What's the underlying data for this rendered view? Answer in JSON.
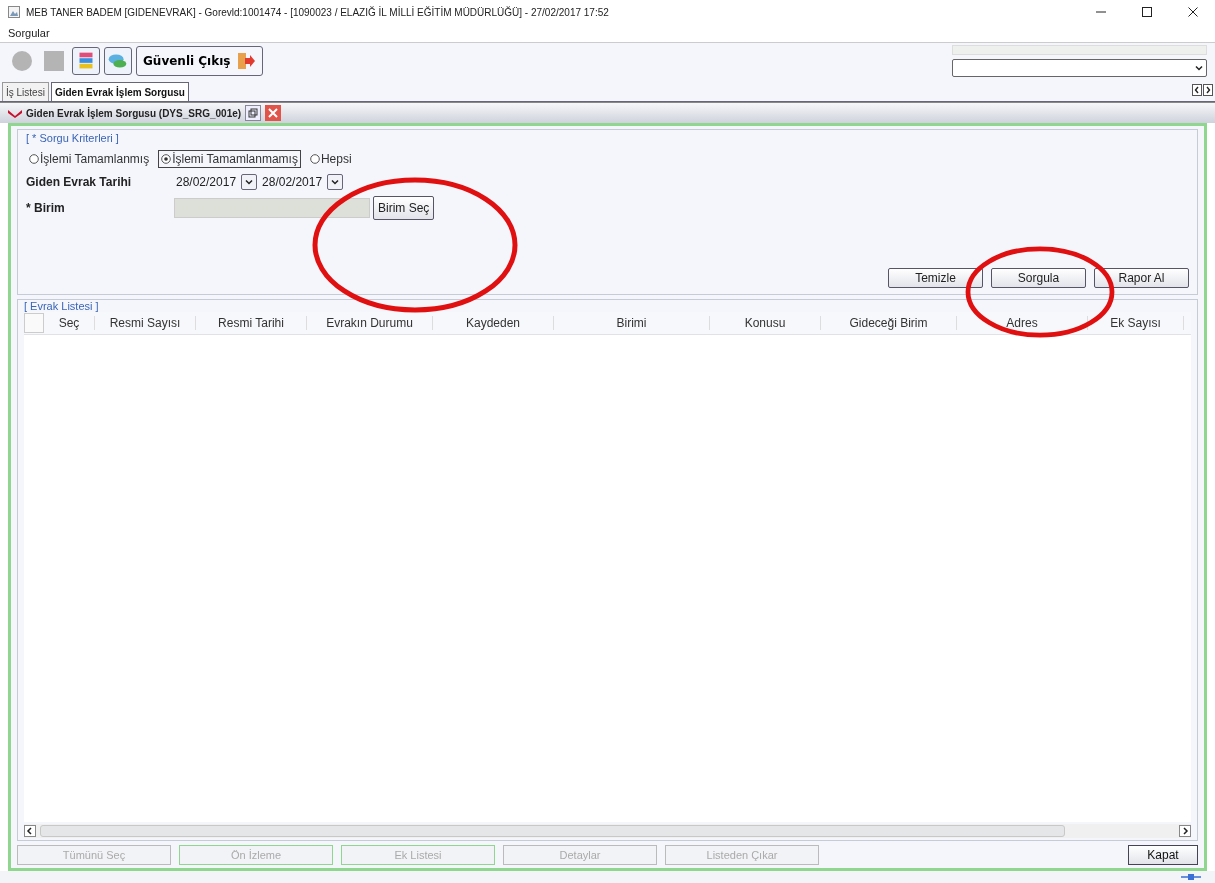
{
  "window": {
    "title": "MEB   TANER BADEM  [GIDENEVRAK] - Gorevld:1001474 - [1090023 / ELAZIĞ İL MİLLİ EĞİTİM MÜDÜRLÜĞÜ] - 27/02/2017 17:52"
  },
  "menu": [
    "Sorgular"
  ],
  "toolbar": {
    "exit_button": "Güvenli Çıkış"
  },
  "tabs": [
    {
      "label": "İş Listesi",
      "selected": false
    },
    {
      "label": "Giden Evrak İşlem Sorgusu",
      "selected": true
    }
  ],
  "frame": {
    "title": "Giden Evrak İşlem Sorgusu (DYS_SRG_001e)"
  },
  "criteria": {
    "legend": "[ * Sorgu Kriterleri ]",
    "status_options": [
      {
        "label": "İşlemi Tamamlanmış",
        "selected": false
      },
      {
        "label": "İşlemi Tamamlanmamış",
        "selected": true
      },
      {
        "label": "Hepsi",
        "selected": false
      }
    ],
    "date_label": "Giden Evrak Tarihi",
    "date_from": "28/02/2017",
    "date_to": "28/02/2017",
    "unit_label": "* Birim",
    "unit_button": "Birim Seç",
    "buttons": [
      "Temizle",
      "Sorgula",
      "Rapor Al"
    ]
  },
  "list": {
    "legend": "[ Evrak Listesi ]",
    "select_all_checked": false,
    "columns": [
      "Seç",
      "Resmi Sayısı",
      "Resmi Tarihi",
      "Evrakın Durumu",
      "Kaydeden",
      "Birimi",
      "Konusu",
      "Gideceği Birim",
      "Adres",
      "Ek Sayısı"
    ]
  },
  "bottom_buttons": [
    {
      "label": "Tümünü Seç",
      "disabled": true
    },
    {
      "label": "Ön İzleme",
      "disabled": true
    },
    {
      "label": "Ek Listesi",
      "disabled": true
    },
    {
      "label": "Detaylar",
      "disabled": true
    },
    {
      "label": "Listeden Çıkar",
      "disabled": true
    },
    {
      "label": "Kapat",
      "disabled": false
    }
  ]
}
